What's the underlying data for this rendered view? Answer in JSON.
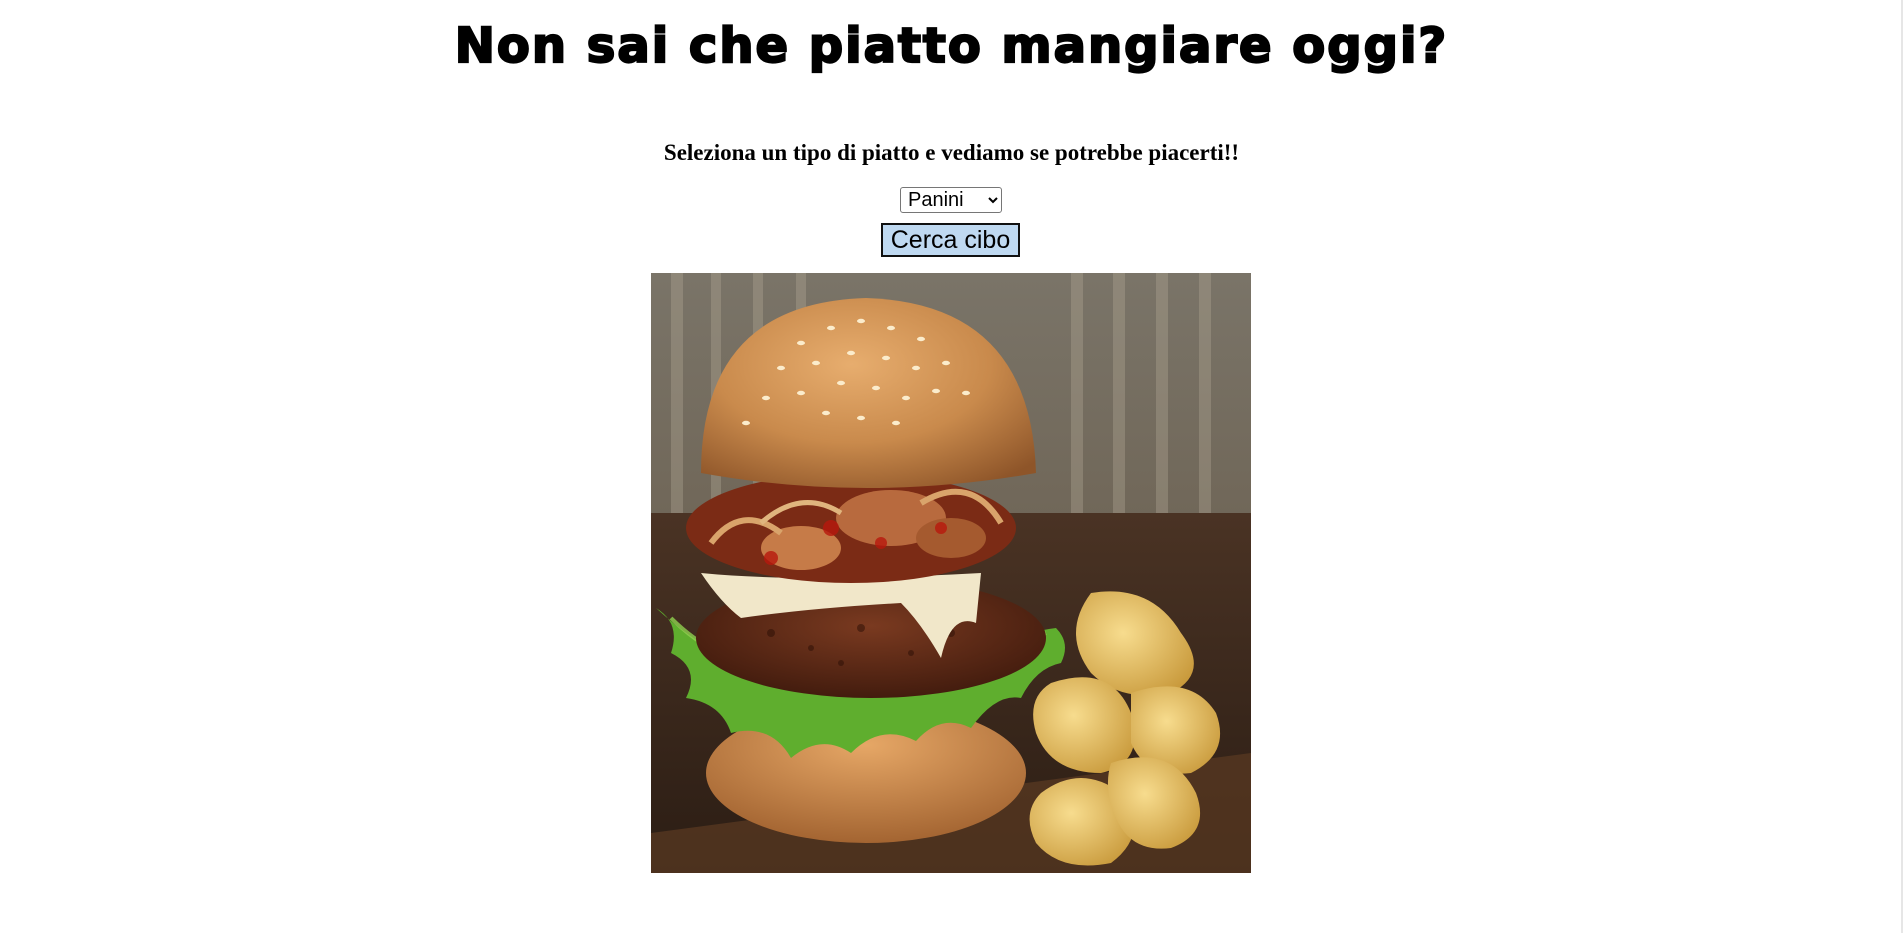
{
  "page": {
    "title": "Non sai che piatto mangiare oggi?",
    "subtitle": "Seleziona un tipo di piatto e vediamo se potrebbe piacerti!!"
  },
  "form": {
    "select_value": "Panini",
    "search_button_label": "Cerca cibo"
  },
  "image": {
    "subject": "burger-with-chips",
    "icon": "burger-photo"
  },
  "colors": {
    "button_bg": "#bfd9f1",
    "background": "#ffffff"
  }
}
